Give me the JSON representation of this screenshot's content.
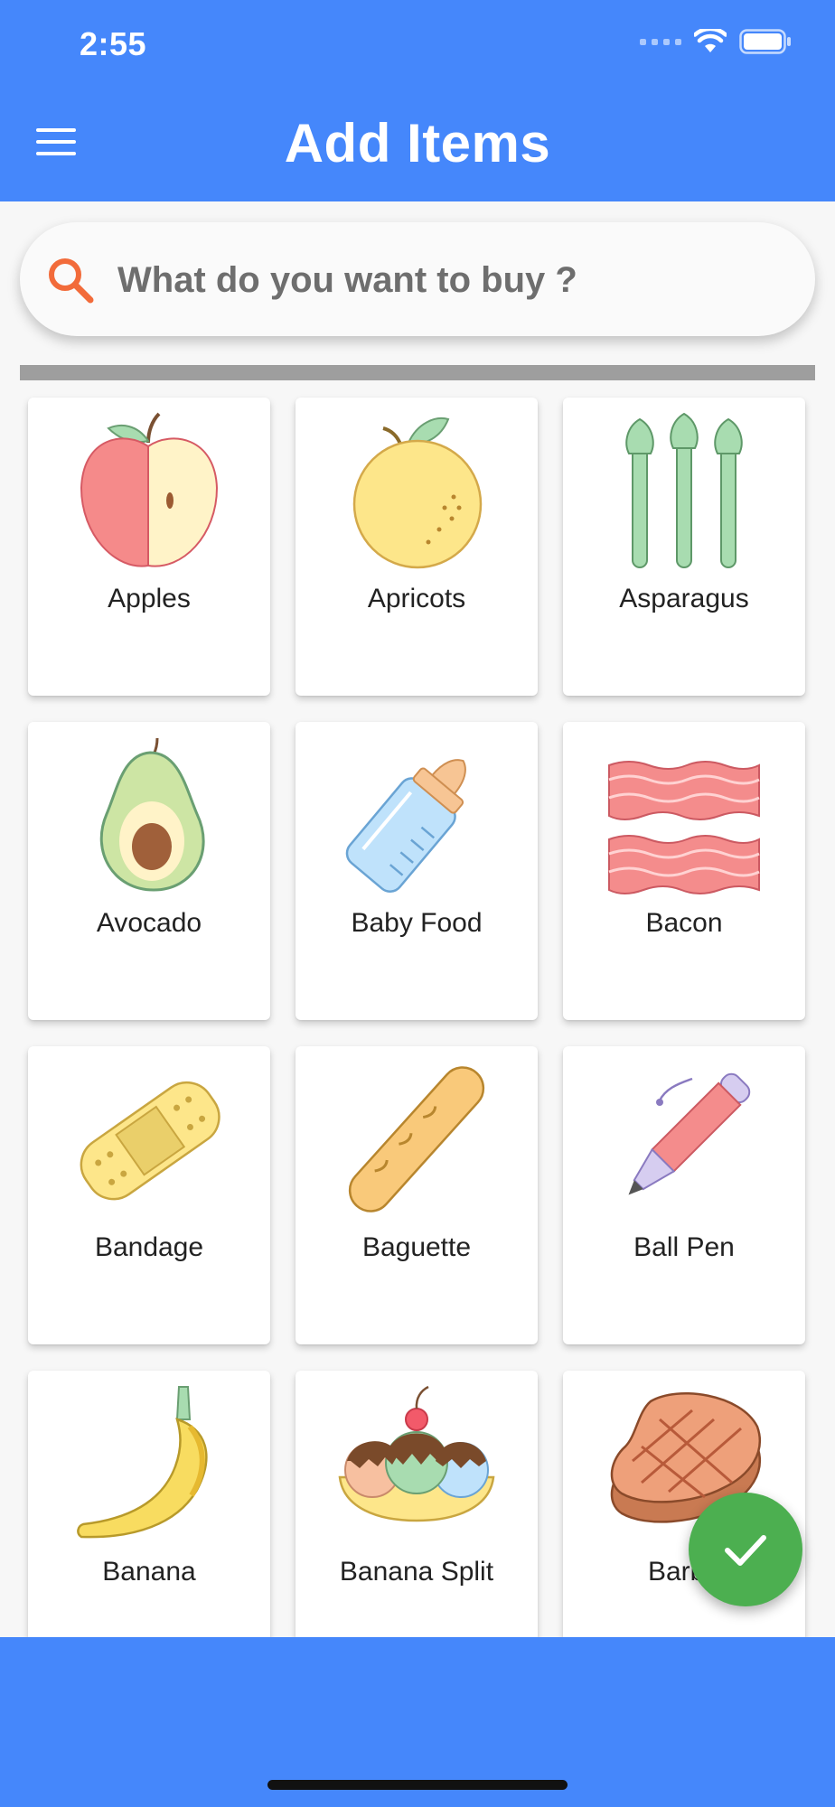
{
  "status_bar": {
    "time": "2:55"
  },
  "header": {
    "title": "Add Items"
  },
  "search": {
    "placeholder": "What do you want to buy ?"
  },
  "items": [
    {
      "label": "Apples",
      "icon": "apple-icon"
    },
    {
      "label": "Apricots",
      "icon": "apricot-icon"
    },
    {
      "label": "Asparagus",
      "icon": "asparagus-icon"
    },
    {
      "label": "Avocado",
      "icon": "avocado-icon"
    },
    {
      "label": "Baby Food",
      "icon": "baby-bottle-icon"
    },
    {
      "label": "Bacon",
      "icon": "bacon-icon"
    },
    {
      "label": "Bandage",
      "icon": "bandage-icon"
    },
    {
      "label": "Baguette",
      "icon": "baguette-icon"
    },
    {
      "label": "Ball Pen",
      "icon": "ball-pen-icon"
    },
    {
      "label": "Banana",
      "icon": "banana-icon"
    },
    {
      "label": "Banana Split",
      "icon": "banana-split-icon"
    },
    {
      "label": "Barbe",
      "icon": "steak-icon"
    }
  ],
  "colors": {
    "primary": "#4587fb",
    "fab": "#4caf50",
    "search_icon": "#f26b3a",
    "progress": "#9e9e9e"
  }
}
